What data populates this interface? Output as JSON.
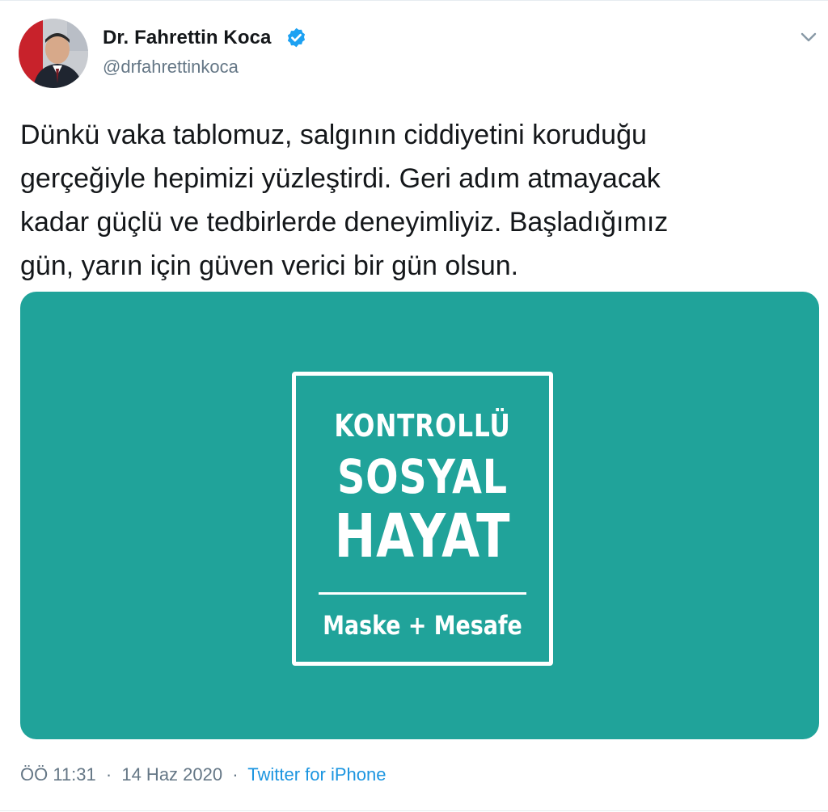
{
  "author": {
    "display_name": "Dr. Fahrettin Koca",
    "handle": "@drfahrettinkoca"
  },
  "tweet": {
    "text_lines": [
      "Dünkü vaka tablomuz, salgının ciddiyetini koruduğu",
      "gerçeğiyle hepimizi yüzleştirdi. Geri adım atmayacak",
      "kadar güçlü ve tedbirlerde deneyimliyiz. Başladığımız",
      "gün, yarın için güven verici bir gün olsun."
    ]
  },
  "media": {
    "line_1": "KONTROLLÜ",
    "line_2": "SOSYAL",
    "line_3": "HAYAT",
    "tagline": "Maske + Mesafe",
    "background_color": "#20a39a"
  },
  "meta": {
    "time": "ÖÖ 11:31",
    "separator": "·",
    "date": "14 Haz 2020",
    "source": "Twitter for iPhone"
  },
  "colors": {
    "text": "#14171a",
    "secondary": "#657786",
    "link": "#1b95e0",
    "verified": "#1da1f2"
  },
  "icons": {
    "verified": "verified-badge-icon",
    "caret": "chevron-down-icon"
  }
}
